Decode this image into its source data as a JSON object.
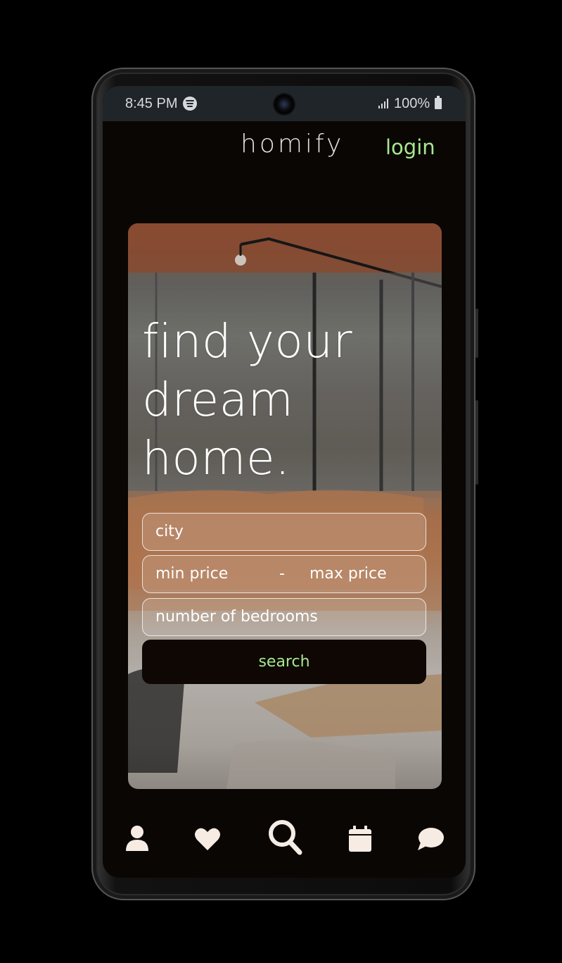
{
  "status_bar": {
    "time": "8:45 PM",
    "battery": "100%",
    "icons": [
      "spotify-icon",
      "signal-icon",
      "battery-icon"
    ]
  },
  "header": {
    "logo": "homify",
    "login": "login"
  },
  "hero": {
    "headline_lines": [
      "find your",
      "dream",
      "home."
    ],
    "city_placeholder": "city",
    "min_price_placeholder": "min price",
    "price_separator": "-",
    "max_price_placeholder": "max price",
    "bedrooms_placeholder": "number of bedrooms",
    "search_label": "search"
  },
  "bottom_nav": {
    "items": [
      {
        "icon": "user-icon"
      },
      {
        "icon": "heart-icon"
      },
      {
        "icon": "search-icon"
      },
      {
        "icon": "calendar-icon"
      },
      {
        "icon": "chat-icon"
      }
    ]
  },
  "colors": {
    "accent": "#a6e88e",
    "background": "#0a0604",
    "status_bar": "#20252a",
    "button": "#0e0704",
    "icon": "#f6ece4"
  }
}
